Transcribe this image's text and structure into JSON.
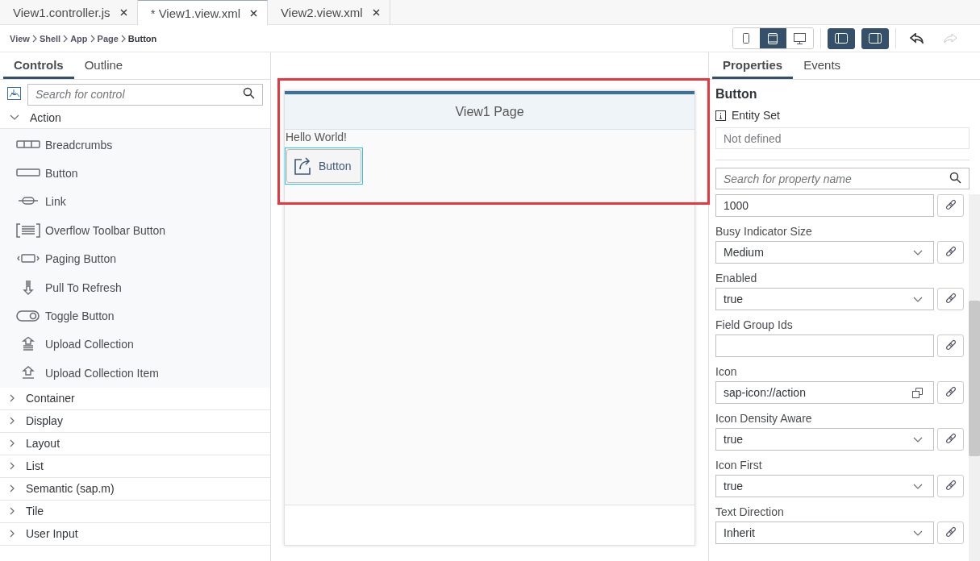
{
  "file_tabs": [
    {
      "label": "View1.controller.js",
      "selected": false
    },
    {
      "label": "* View1.view.xml",
      "selected": true
    },
    {
      "label": "View2.view.xml",
      "selected": false
    }
  ],
  "breadcrumbs": [
    "View",
    "Shell",
    "App",
    "Page",
    "Button"
  ],
  "toolbar": {
    "devices": [
      {
        "kind": "phone",
        "selected": false
      },
      {
        "kind": "tablet",
        "selected": true
      },
      {
        "kind": "desktop",
        "selected": false
      }
    ],
    "panels": [
      {
        "kind": "left",
        "on": true
      },
      {
        "kind": "right",
        "on": true
      }
    ],
    "history": [
      {
        "kind": "undo",
        "disabled": false
      },
      {
        "kind": "redo",
        "disabled": true
      }
    ]
  },
  "left_panel": {
    "tabs": [
      {
        "label": "Controls",
        "selected": true
      },
      {
        "label": "Outline",
        "selected": false
      }
    ],
    "search": {
      "placeholder": "Search for control"
    },
    "categories": [
      {
        "label": "Action",
        "expanded": true,
        "items": [
          {
            "label": "Breadcrumbs",
            "kind": "breadcrumbs"
          },
          {
            "label": "Button",
            "kind": "button"
          },
          {
            "label": "Link",
            "kind": "link"
          },
          {
            "label": "Overflow Toolbar Button",
            "kind": "overflow"
          },
          {
            "label": "Paging Button",
            "kind": "paging"
          },
          {
            "label": "Pull To Refresh",
            "kind": "pull"
          },
          {
            "label": "Toggle Button",
            "kind": "toggle"
          },
          {
            "label": "Upload Collection",
            "kind": "upload-collection"
          },
          {
            "label": "Upload Collection Item",
            "kind": "upload-item"
          }
        ]
      },
      {
        "label": "Container",
        "expanded": false
      },
      {
        "label": "Display",
        "expanded": false
      },
      {
        "label": "Layout",
        "expanded": false
      },
      {
        "label": "List",
        "expanded": false
      },
      {
        "label": "Semantic (sap.m)",
        "expanded": false
      },
      {
        "label": "Tile",
        "expanded": false
      },
      {
        "label": "User Input",
        "expanded": false
      }
    ]
  },
  "canvas": {
    "page_title": "View1 Page",
    "text": "Hello World!",
    "button": {
      "label": "Button",
      "selected": true
    },
    "highlighted": true
  },
  "right_panel": {
    "tabs": [
      {
        "label": "Properties",
        "selected": true
      },
      {
        "label": "Events",
        "selected": false
      }
    ],
    "title": "Button",
    "entity_set": {
      "label": "Entity Set",
      "placeholder": "Not defined"
    },
    "search": {
      "placeholder": "Search for property name"
    },
    "properties": [
      {
        "kind": "input",
        "value": "1000"
      },
      {
        "label": "Busy Indicator Size",
        "kind": "select",
        "value": "Medium"
      },
      {
        "label": "Enabled",
        "kind": "select",
        "value": "true"
      },
      {
        "label": "Field Group Ids",
        "kind": "input"
      },
      {
        "label": "Icon",
        "kind": "icon-input",
        "value": "sap-icon://action"
      },
      {
        "label": "Icon Density Aware",
        "kind": "select",
        "value": "true"
      },
      {
        "label": "Icon First",
        "kind": "select",
        "value": "true"
      },
      {
        "label": "Text Direction",
        "kind": "select",
        "value": "Inherit"
      }
    ]
  }
}
